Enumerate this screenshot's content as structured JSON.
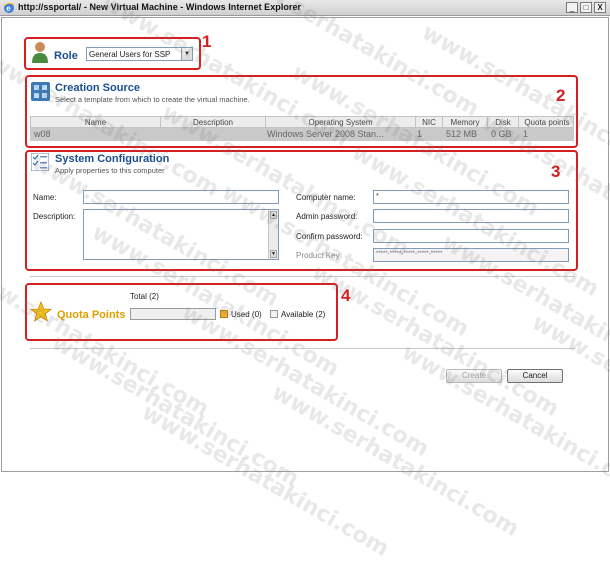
{
  "window": {
    "title": "http://ssportal/ - New Virtual Machine - Windows Internet Explorer",
    "min_label": "_",
    "max_label": "□",
    "close_label": "X"
  },
  "annotations": {
    "n1": "1",
    "n2": "2",
    "n3": "3",
    "n4": "4"
  },
  "role": {
    "label": "Role",
    "selected": "General Users for SSP"
  },
  "creation_source": {
    "title": "Creation Source",
    "subtitle": "Select a template from which to create the virtual machine.",
    "columns": [
      "Name",
      "Description",
      "Operating System",
      "NIC",
      "Memory",
      "Disk",
      "Quota points"
    ],
    "rows": [
      {
        "name": "w08",
        "description": "",
        "os": "Windows Server 2008 Stan...",
        "nic": "1",
        "memory": "512 MB",
        "disk": "0 GB",
        "quota": "1"
      }
    ]
  },
  "system_config": {
    "title": "System Configuration",
    "subtitle": "Apply properties to this computer",
    "name_label": "Name:",
    "description_label": "Description:",
    "computer_name_label": "Computer name:",
    "computer_name_value": "*",
    "admin_password_label": "Admin password:",
    "confirm_password_label": "Confirm password:",
    "product_key_label": "Product Key",
    "product_key_placeholder": "*****-*****-*****-*****-*****"
  },
  "quota": {
    "title": "Quota Points",
    "total_label": "Total (2)",
    "used_label": "Used (0)",
    "available_label": "Available (2)",
    "used_fraction": 0
  },
  "buttons": {
    "create": "Create",
    "cancel": "Cancel"
  },
  "watermark": "www.serhatakinci.com",
  "colors": {
    "annotation_red": "#d42020",
    "section_blue": "#1b4f91",
    "row_selected": "#c9c9c9"
  }
}
